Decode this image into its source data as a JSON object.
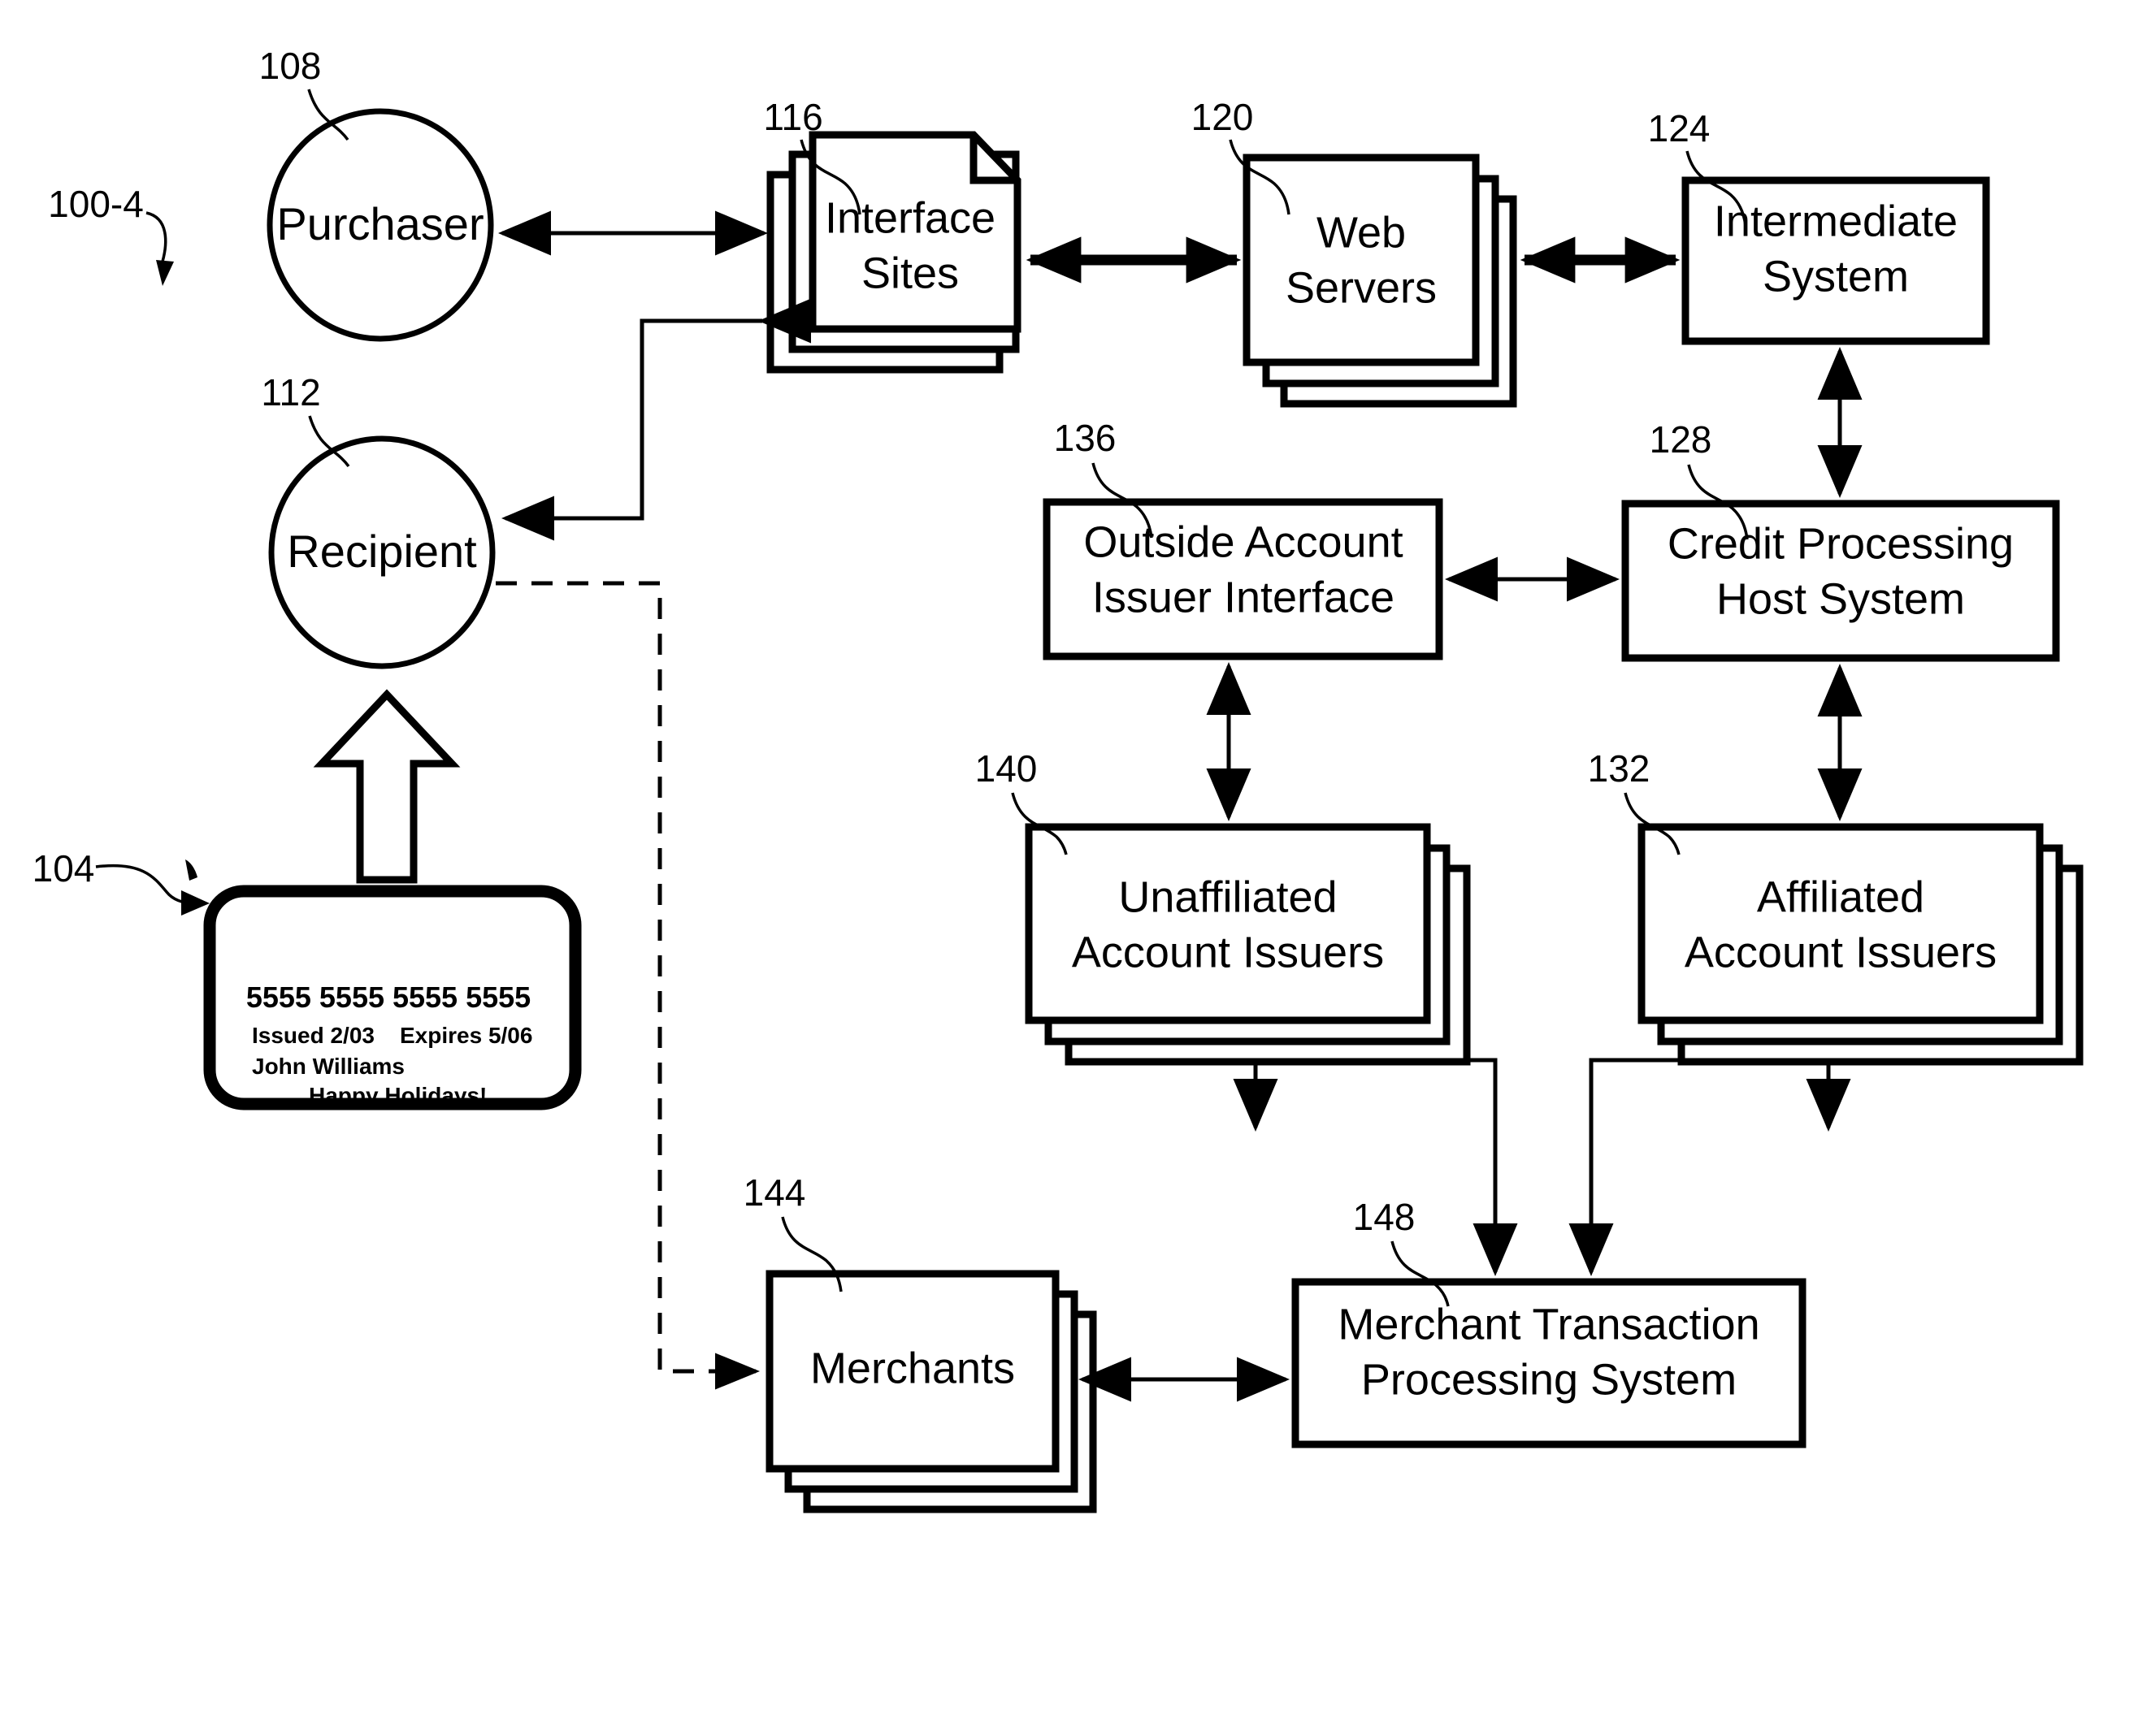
{
  "figure": {
    "figure_number": "100-4"
  },
  "nodes": {
    "purchaser": {
      "ref": "108",
      "label": "Purchaser",
      "shape": "ellipse"
    },
    "recipient": {
      "ref": "112",
      "label": "Recipient",
      "shape": "ellipse"
    },
    "interface_sites": {
      "ref": "116",
      "label_line1": "Interface",
      "label_line2": "Sites",
      "shape": "stacked-document"
    },
    "web_servers": {
      "ref": "120",
      "label_line1": "Web",
      "label_line2": "Servers",
      "shape": "stacked-box"
    },
    "intermediate_system": {
      "ref": "124",
      "label_line1": "Intermediate",
      "label_line2": "System",
      "shape": "box"
    },
    "credit_processing_host_system": {
      "ref": "128",
      "label_line1": "Credit Processing",
      "label_line2": "Host System",
      "shape": "box"
    },
    "outside_account_issuer_interface": {
      "ref": "136",
      "label_line1": "Outside Account",
      "label_line2": "Issuer Interface",
      "shape": "box"
    },
    "affiliated_account_issuers": {
      "ref": "132",
      "label_line1": "Affiliated",
      "label_line2": "Account Issuers",
      "shape": "stacked-box"
    },
    "unaffiliated_account_issuers": {
      "ref": "140",
      "label_line1": "Unaffiliated",
      "label_line2": "Account Issuers",
      "shape": "stacked-box"
    },
    "merchants": {
      "ref": "144",
      "label": "Merchants",
      "shape": "stacked-box"
    },
    "merchant_transaction_processing_system": {
      "ref": "148",
      "label_line1": "Merchant Transaction",
      "label_line2": "Processing System",
      "shape": "box"
    },
    "gift_card": {
      "ref": "104",
      "shape": "rounded-card",
      "number": "5555 5555 5555 5555",
      "issued": "Issued 2/03",
      "expires": "Expires 5/06",
      "holder": "John Williams",
      "message": "Happy Holidays!"
    }
  },
  "colors": {
    "ink": "#000000",
    "paper": "#ffffff"
  }
}
